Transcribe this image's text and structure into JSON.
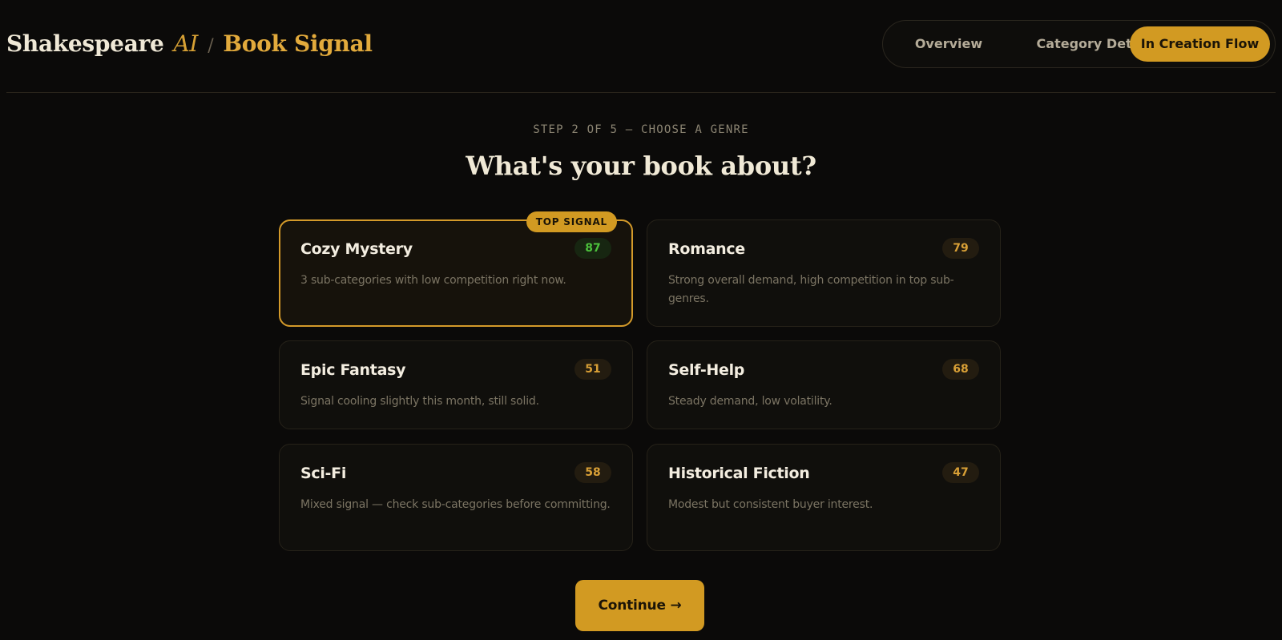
{
  "brand": {
    "name": "Shakespeare",
    "ai": "AI",
    "separator": "/",
    "product": "Book Signal"
  },
  "nav": {
    "items": [
      {
        "label": "Overview",
        "active": false
      },
      {
        "label": "Category Detail",
        "active": false
      },
      {
        "label": "In Creation Flow",
        "active": true
      }
    ]
  },
  "step": {
    "label": "STEP 2 OF 5 — CHOOSE A GENRE",
    "title": "What's your book about?"
  },
  "genres": [
    {
      "name": "Cozy Mystery",
      "score": "87",
      "description": "3 sub-categories with low competition right now.",
      "selected": true,
      "badge": "TOP SIGNAL"
    },
    {
      "name": "Romance",
      "score": "79",
      "description": "Strong overall demand, high competition in top sub-genres.",
      "selected": false
    },
    {
      "name": "Epic Fantasy",
      "score": "51",
      "description": "Signal cooling slightly this month, still solid.",
      "selected": false
    },
    {
      "name": "Self-Help",
      "score": "68",
      "description": "Steady demand, low volatility.",
      "selected": false
    },
    {
      "name": "Sci-Fi",
      "score": "58",
      "description": "Mixed signal — check sub-categories before committing.",
      "selected": false
    },
    {
      "name": "Historical Fiction",
      "score": "47",
      "description": "Modest but consistent buyer interest.",
      "selected": false
    }
  ],
  "continue_label": "Continue →",
  "colors": {
    "background": "#0b0a09",
    "accent": "#d29a22",
    "top_score": "#4cc23c",
    "score": "#d9a036"
  }
}
